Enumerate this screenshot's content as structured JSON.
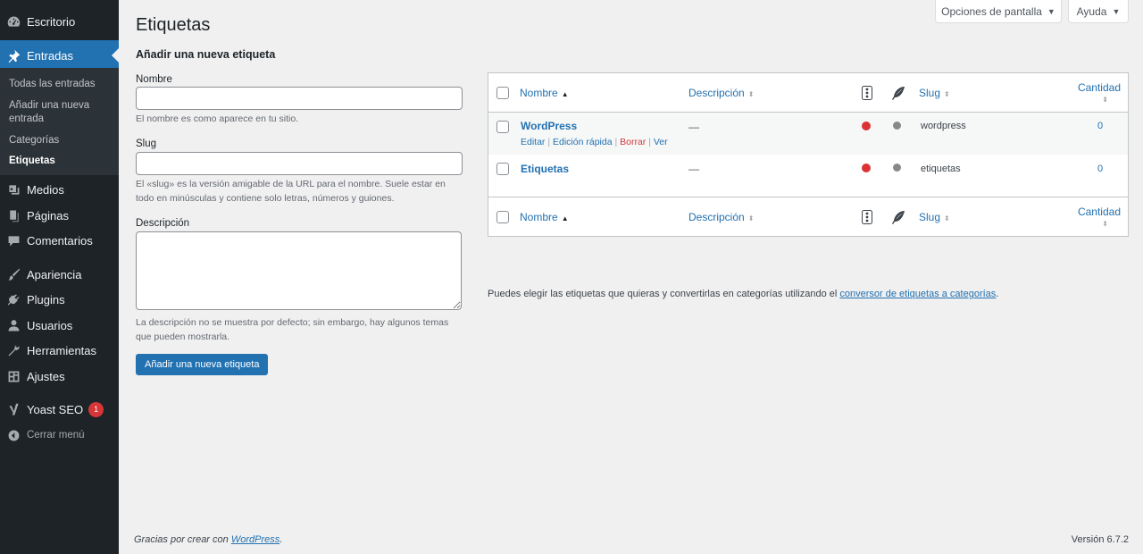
{
  "sidebar": {
    "dashboard": "Escritorio",
    "posts": "Entradas",
    "submenu": [
      "Todas las entradas",
      "Añadir una nueva entrada",
      "Categorías",
      "Etiquetas"
    ],
    "media": "Medios",
    "pages": "Páginas",
    "comments": "Comentarios",
    "appearance": "Apariencia",
    "plugins": "Plugins",
    "users": "Usuarios",
    "tools": "Herramientas",
    "settings": "Ajustes",
    "yoast": "Yoast SEO",
    "yoast_badge": "1",
    "collapse": "Cerrar menú"
  },
  "header": {
    "title": "Etiquetas",
    "screen_options": "Opciones de pantalla",
    "help": "Ayuda"
  },
  "form": {
    "heading": "Añadir una nueva etiqueta",
    "name_label": "Nombre",
    "name_value": "",
    "name_help": "El nombre es como aparece en tu sitio.",
    "slug_label": "Slug",
    "slug_value": "",
    "slug_help": "El «slug» es la versión amigable de la URL para el nombre. Suele estar en todo en minúsculas y contiene solo letras, números y guiones.",
    "desc_label": "Descripción",
    "desc_help": "La descripción no se muestra por defecto; sin embargo, hay algunos temas que pueden mostrarla.",
    "submit": "Añadir una nueva etiqueta"
  },
  "table": {
    "columns": {
      "name": "Nombre",
      "description": "Descripción",
      "slug": "Slug",
      "count": "Cantidad"
    },
    "rows": [
      {
        "name": "WordPress",
        "description": "—",
        "slug": "wordpress",
        "count": "0",
        "actions": [
          "Editar",
          "Edición rápida",
          "Borrar",
          "Ver"
        ]
      },
      {
        "name": "Etiquetas",
        "description": "—",
        "slug": "etiquetas",
        "count": "0"
      }
    ]
  },
  "note": {
    "text": "Puedes elegir las etiquetas que quieras y convertirlas en categorías utilizando el ",
    "link": "conversor de etiquetas a categorías",
    "end": "."
  },
  "footer": {
    "thanks": "Gracias por crear con ",
    "link": "WordPress",
    "end": ".",
    "version": "Versión 6.7.2"
  },
  "colors": {
    "accent": "#2271b1",
    "sidebar_bg": "#1d2327",
    "danger": "#d63638",
    "seo_bad": "#dc3232"
  }
}
